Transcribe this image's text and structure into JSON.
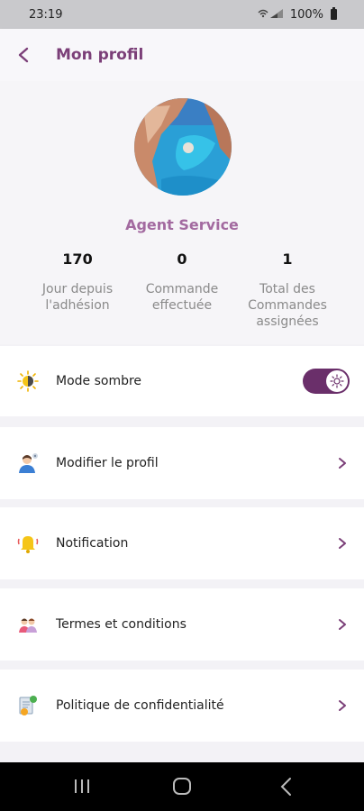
{
  "status_bar": {
    "time": "23:19",
    "battery": "100%",
    "icons": "wifi-icon signal-icon"
  },
  "header": {
    "title": "Mon profil"
  },
  "profile": {
    "name": "Agent Service",
    "stats": [
      {
        "value": "170",
        "label": "Jour depuis\nl'adhésion"
      },
      {
        "value": "0",
        "label": "Commande\neffectuée"
      },
      {
        "value": "1",
        "label": "Total des\nCommandes\nassignées"
      }
    ]
  },
  "settings": {
    "dark_mode": {
      "label": "Mode sombre",
      "enabled": true
    },
    "items": [
      {
        "label": "Modifier le profil",
        "icon": "user-edit-icon"
      },
      {
        "label": "Notification",
        "icon": "bell-icon"
      },
      {
        "label": "Termes et conditions",
        "icon": "people-icon"
      },
      {
        "label": "Politique de confidentialité",
        "icon": "privacy-document-icon"
      }
    ]
  },
  "colors": {
    "accent": "#7b3f78",
    "name": "#a36aa0",
    "toggle": "#6a2f6a"
  }
}
